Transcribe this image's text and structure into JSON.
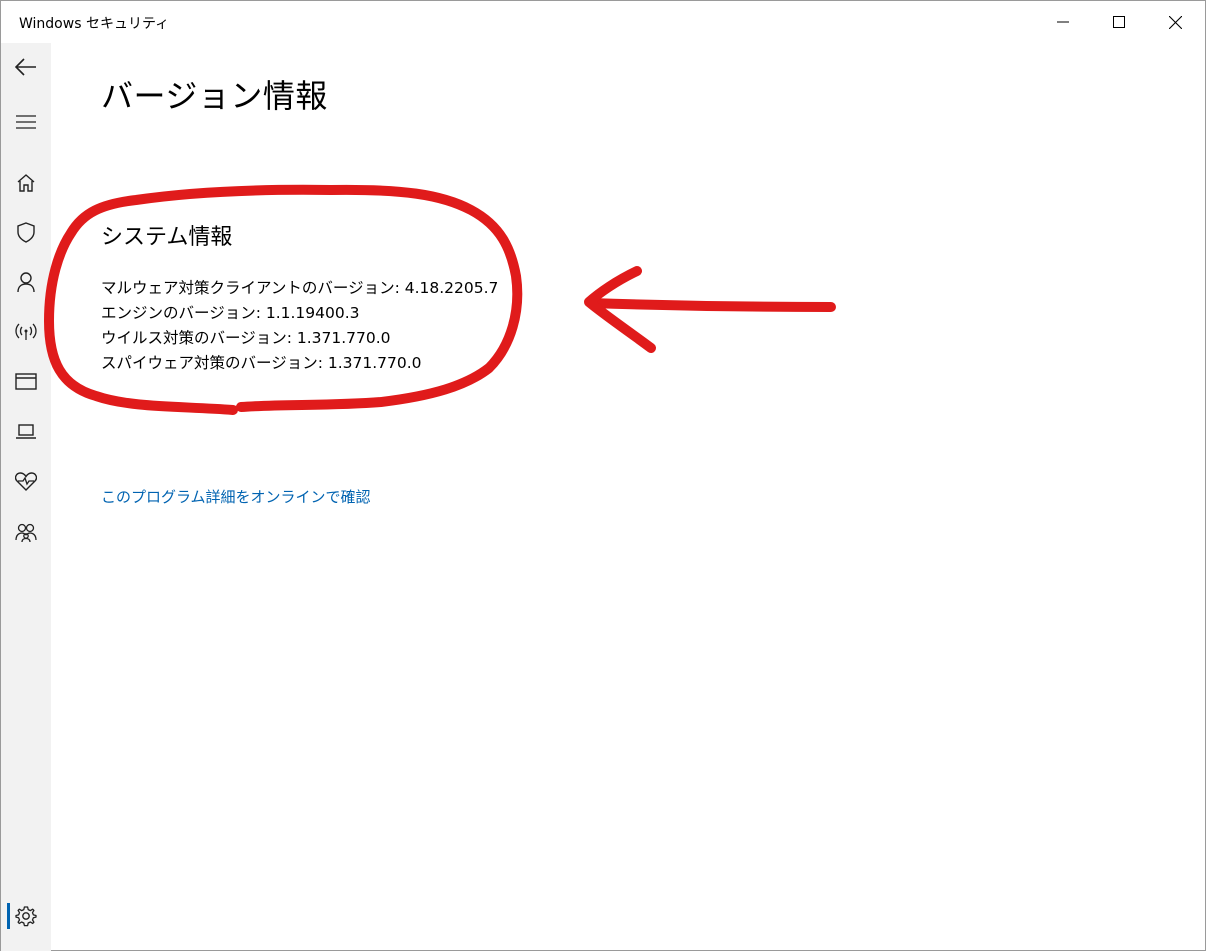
{
  "window": {
    "title": "Windows セキュリティ"
  },
  "sidebar": {
    "items": [
      {
        "icon": "back-arrow-icon"
      },
      {
        "icon": "hamburger-menu-icon"
      },
      {
        "icon": "home-icon"
      },
      {
        "icon": "shield-icon"
      },
      {
        "icon": "person-icon"
      },
      {
        "icon": "wifi-antenna-icon"
      },
      {
        "icon": "app-browser-icon"
      },
      {
        "icon": "laptop-icon"
      },
      {
        "icon": "heart-health-icon"
      },
      {
        "icon": "family-icon"
      },
      {
        "icon": "gear-icon",
        "active": true
      }
    ]
  },
  "main": {
    "page_title": "バージョン情報",
    "section_title": "システム情報",
    "info": {
      "malware_client": "マルウェア対策クライアントのバージョン: 4.18.2205.7",
      "engine": "エンジンのバージョン: 1.1.19400.3",
      "antivirus": "ウイルス対策のバージョン: 1.371.770.0",
      "antispyware": "スパイウェア対策のバージョン: 1.371.770.0"
    },
    "online_link": "このプログラム詳細をオンラインで確認"
  },
  "colors": {
    "link": "#0063b1",
    "sidebar_bg": "#f2f2f2",
    "annotation_red": "#e01b1b",
    "active_indicator": "#0063b1"
  }
}
